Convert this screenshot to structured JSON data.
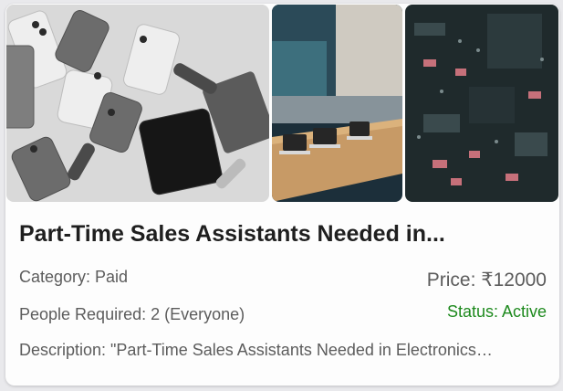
{
  "listing": {
    "title": "Part-Time Sales Assistants Needed in...",
    "category": "Category: Paid",
    "people_required": "People Required: 2 (Everyone)",
    "description": "Description: \"Part-Time Sales Assistants Needed in Electronics…",
    "price": "Price: ₹12000",
    "status": "Status: Active"
  },
  "images": [
    {
      "icon": "apple-devices-flatlay-photo"
    },
    {
      "icon": "apple-store-display-photo"
    },
    {
      "icon": "circuit-board-closeup-photo"
    }
  ],
  "colors": {
    "status_active": "#1e8a1e",
    "text_primary": "#1f1f1f",
    "text_secondary": "#5c5c5c"
  }
}
